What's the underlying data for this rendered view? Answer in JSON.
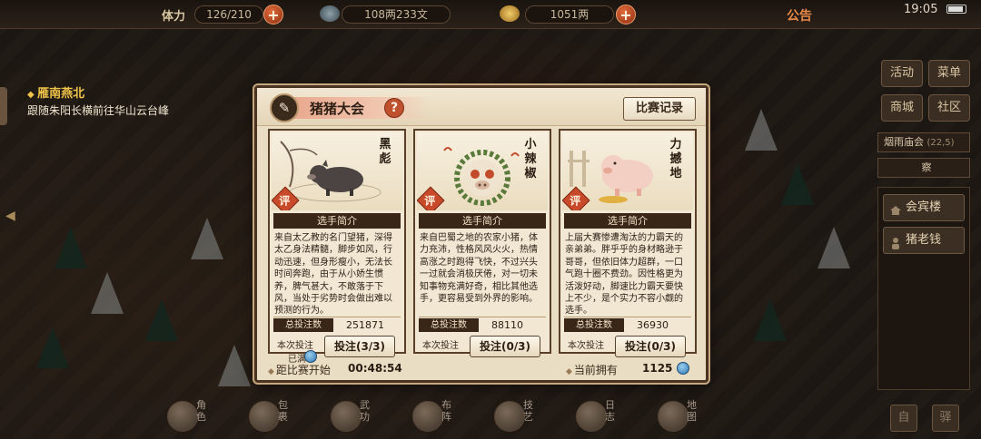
{
  "topbar": {
    "stamina_label": "体力",
    "stamina_value": "126/210",
    "money_value": "108两233文",
    "gold_value": "1051两",
    "notice": "公告",
    "clock": "19:05"
  },
  "quest": {
    "title": "雁南燕北",
    "desc": "跟随朱阳长横前往华山云台峰"
  },
  "right_menu": {
    "buttons": [
      "活动",
      "菜单",
      "商城",
      "社区"
    ],
    "event_bar": "烟雨庙会",
    "event_bar_value": "(22,5)",
    "event_bar2": "察",
    "panel_items": [
      "会宾楼",
      "猪老钱"
    ]
  },
  "dock": {
    "items": [
      "角色",
      "包裹",
      "武功",
      "布阵",
      "技艺",
      "日志",
      "地图"
    ],
    "right_buttons": [
      "自",
      "驿"
    ]
  },
  "dialog": {
    "title": "猪猪大会",
    "help": "?",
    "record_button": "比赛记录",
    "countdown_label": "距比赛开始",
    "countdown_value": "00:48:54",
    "owned_label": "当前拥有",
    "owned_value": "1125",
    "cards": [
      {
        "name": "黑彪",
        "badge": "评",
        "section_title": "选手简介",
        "desc": "来自太乙教的名门望猪，深得太乙身法精髓，脚步如风，行动迅速，但身形瘦小，无法长时间奔跑，由于从小娇生惯养，脾气甚大，不敢落于下风，当处于劣势时会做出难以预测的行为。",
        "total_label": "总投注数",
        "total_value": "251871",
        "bet_label": "本次投注",
        "bet_status": "已满",
        "bet_button": "投注(3/3)"
      },
      {
        "name": "小辣椒",
        "badge": "评",
        "section_title": "选手简介",
        "desc": "来自巴蜀之地的农家小猪，体力充沛，性格风风火火，热情高涨之时跑得飞快，不过兴头一过就会消极厌倦，对一切未知事物充满好奇，相比其他选手，更容易受到外界的影响。",
        "total_label": "总投注数",
        "total_value": "88110",
        "bet_label": "本次投注",
        "bet_status": "",
        "bet_button": "投注(0/3)"
      },
      {
        "name": "力撼地",
        "badge": "评",
        "section_title": "选手简介",
        "desc": "上届大赛惨遭淘汰的力霸天的亲弟弟。胖乎乎的身材略逊于哥哥，但依旧体力超群，一口气跑十圈不费劲。因性格更为活泼好动，脚速比力霸天要快上不少，是个实力不容小觑的选手。",
        "total_label": "总投注数",
        "total_value": "36930",
        "bet_label": "本次投注",
        "bet_status": "",
        "bet_button": "投注(0/3)"
      }
    ]
  },
  "colors": {
    "accent": "#c84a2a",
    "panel": "#e9ddc3",
    "dark_band": "#3a2617"
  }
}
